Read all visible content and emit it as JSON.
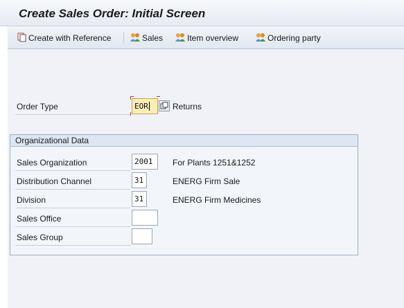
{
  "window": {
    "title": "Create Sales Order: Initial Screen"
  },
  "toolbar": {
    "items": [
      {
        "label": "Create with Reference",
        "icon": "document-copy-icon"
      },
      {
        "label": "Sales",
        "icon": "persons-icon"
      },
      {
        "label": "Item overview",
        "icon": "persons-icon"
      },
      {
        "label": "Ordering party",
        "icon": "persons-icon"
      }
    ]
  },
  "order": {
    "label": "Order Type",
    "value": "EOR",
    "description": "Returns"
  },
  "org": {
    "heading": "Organizational Data",
    "rows": [
      {
        "label": "Sales Organization",
        "value": "2001",
        "description": "For Plants 1251&1252"
      },
      {
        "label": "Distribution Channel",
        "value": "31",
        "description": "ENERG Firm Sale"
      },
      {
        "label": "Division",
        "value": "31",
        "description": "ENERG Firm Medicines"
      },
      {
        "label": "Sales Office",
        "value": "",
        "description": ""
      },
      {
        "label": "Sales Group",
        "value": "",
        "description": ""
      }
    ]
  },
  "colors": {
    "focus_field": "#fdeeb8",
    "header_bg": "#dde6f2"
  }
}
